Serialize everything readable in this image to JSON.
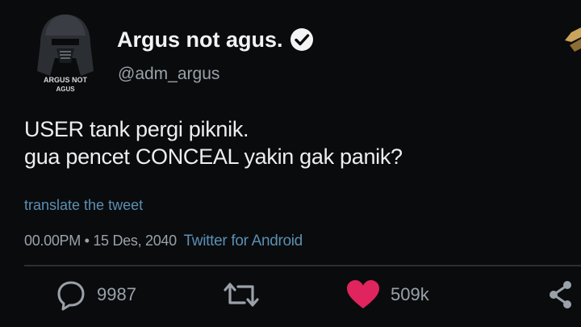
{
  "avatar": {
    "logo_text_line1": "ARGUS NOT",
    "logo_text_line2": "AGUS"
  },
  "user": {
    "display_name": "Argus not agus.",
    "handle": "@adm_argus"
  },
  "tweet": {
    "line1": "USER tank pergi piknik.",
    "line2": "gua pencet CONCEAL yakin gak panik?"
  },
  "translate_label": "translate the tweet",
  "meta": {
    "timestamp": "00.00PM • 15 Des, 2040",
    "client": "Twitter for Android"
  },
  "actions": {
    "replies": "9987",
    "likes": "509k"
  },
  "colors": {
    "background": "#0a0b0d",
    "link": "#5b8fb4",
    "like": "#e0245e",
    "muted": "#9aa1a9"
  },
  "icons": [
    "verified-badge-icon",
    "reply-icon",
    "retweet-icon",
    "heart-icon",
    "share-icon"
  ]
}
